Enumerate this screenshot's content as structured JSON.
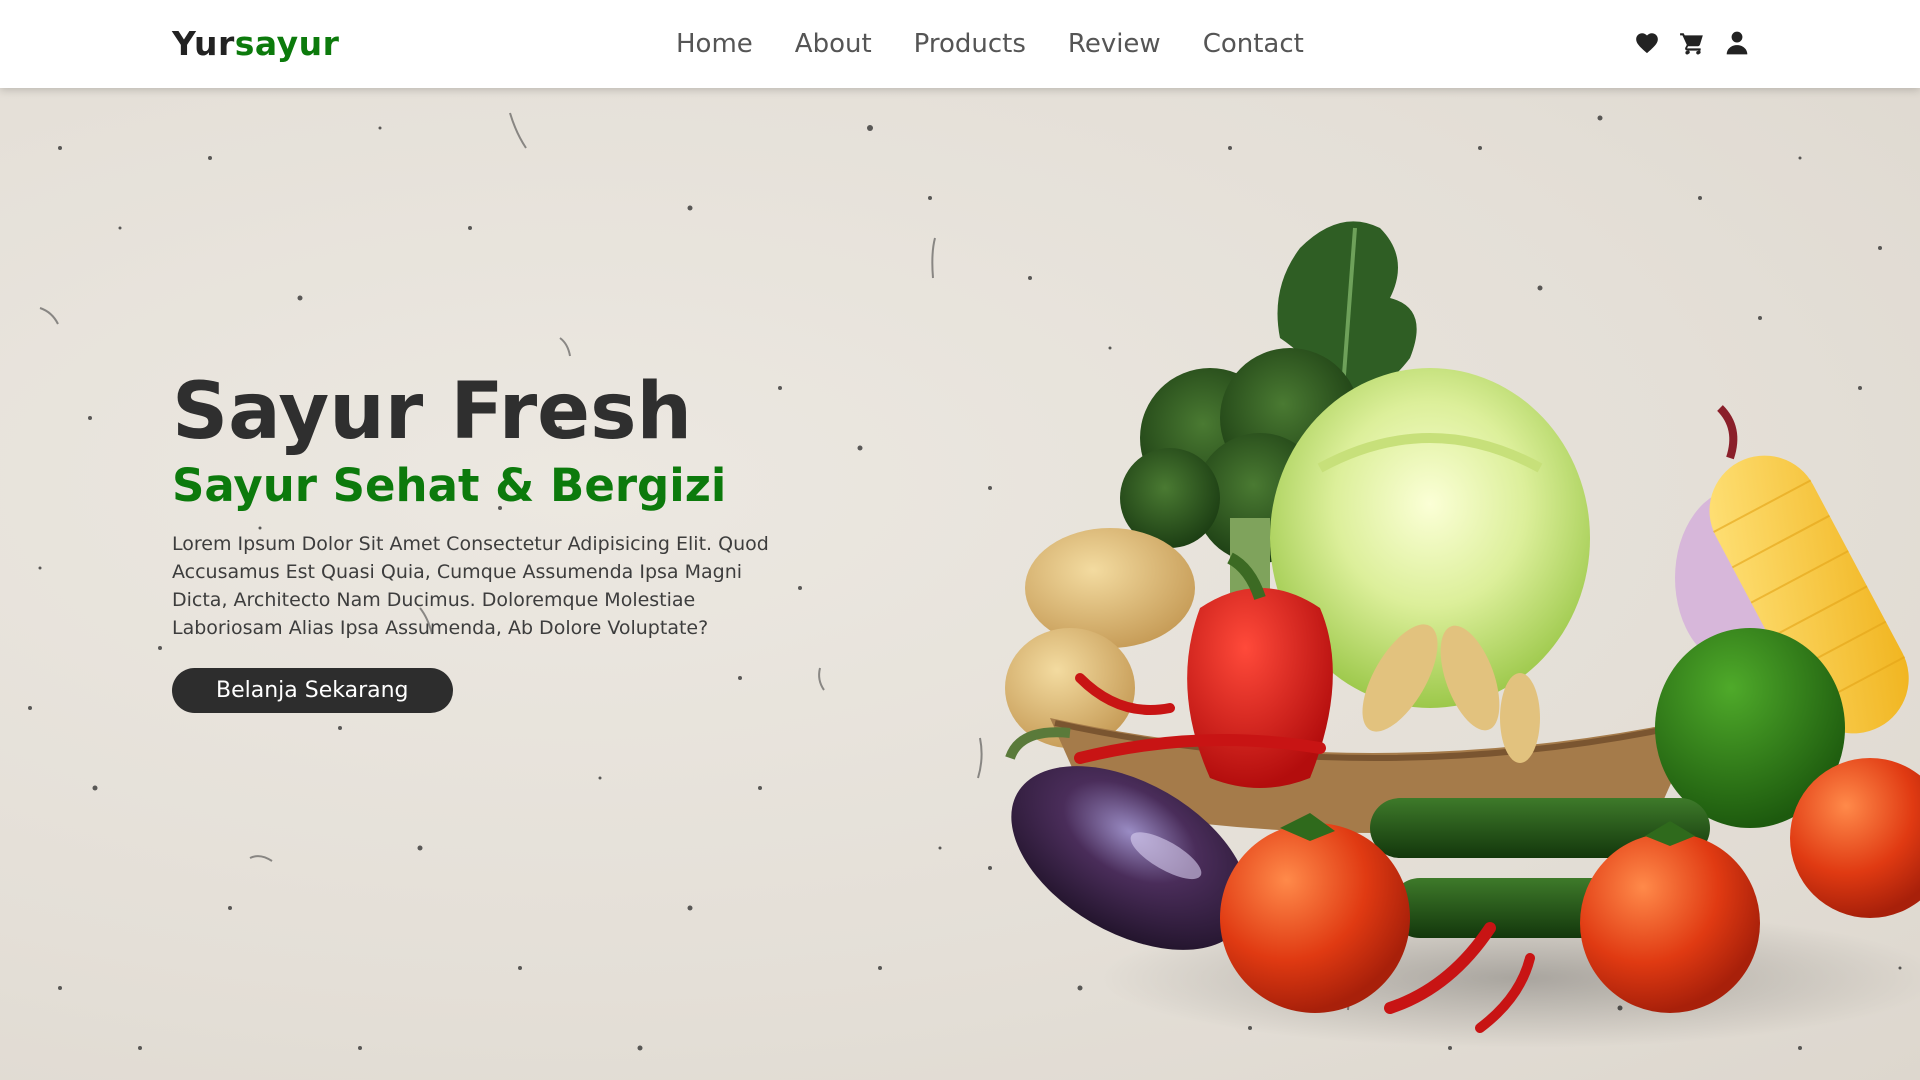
{
  "brand": {
    "prefix": "Yur",
    "accent": "sayur"
  },
  "nav": {
    "links": [
      "Home",
      "About",
      "Products",
      "Review",
      "Contact"
    ],
    "icons": [
      "heart-icon",
      "cart-icon",
      "user-icon"
    ]
  },
  "hero": {
    "title": "Sayur Fresh",
    "subtitle": "Sayur Sehat & Bergizi",
    "description": "Lorem Ipsum Dolor Sit Amet Consectetur Adipisicing Elit. Quod Accusamus Est Quasi Quia, Cumque Assumenda Ipsa Magni Dicta, Architecto Nam Ducimus. Doloremque Molestiae Laboriosam Alias Ipsa Assumenda, Ab Dolore Voluptate?",
    "cta_label": "Belanja Sekarang"
  },
  "colors": {
    "accent": "#0c7a0c",
    "text_dark": "#2f2f2f",
    "button_bg": "#2d2d2d",
    "background": "#e9e5de"
  }
}
